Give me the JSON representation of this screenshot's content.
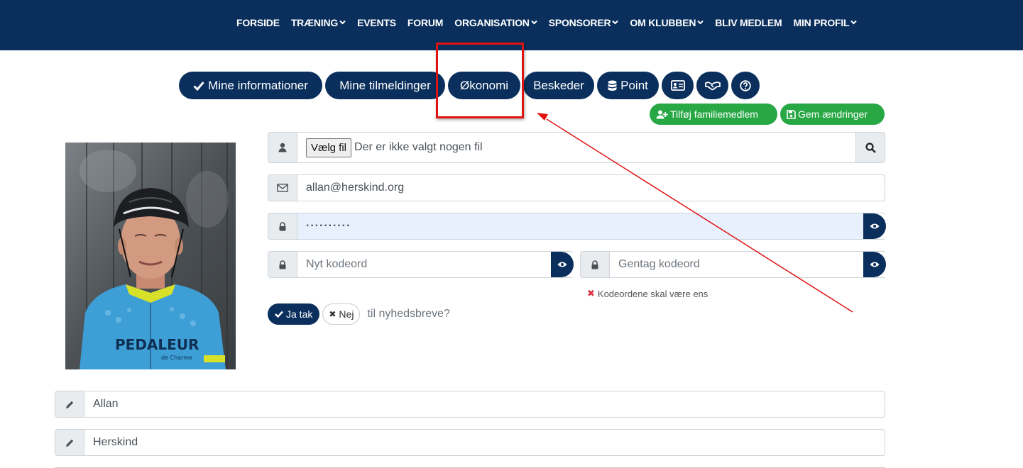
{
  "nav": {
    "items": [
      {
        "label": "FORSIDE",
        "dropdown": false
      },
      {
        "label": "TRÆNING",
        "dropdown": true
      },
      {
        "label": "EVENTS",
        "dropdown": false
      },
      {
        "label": "FORUM",
        "dropdown": false
      },
      {
        "label": "ORGANISATION",
        "dropdown": true
      },
      {
        "label": "SPONSORER",
        "dropdown": true
      },
      {
        "label": "OM KLUBBEN",
        "dropdown": true
      },
      {
        "label": "BLIV MEDLEM",
        "dropdown": false
      },
      {
        "label": "MIN PROFIL",
        "dropdown": true
      }
    ]
  },
  "tabs": {
    "mine_informationer": "Mine informationer",
    "mine_tilmeldinger": "Mine tilmeldinger",
    "okonomi": "Økonomi",
    "beskeder": "Beskeder",
    "point": "Point",
    "icons": [
      "id-card-icon",
      "handshake-icon",
      "question-circle-icon"
    ]
  },
  "actions": {
    "add_family": "Tilføj familiemedlem",
    "save": "Gem ændringer"
  },
  "form": {
    "file_button": "Vælg fil",
    "file_status": "Der er ikke valgt nogen fil",
    "email": "allan@herskind.org",
    "password_masked": "··········",
    "new_password_placeholder": "Nyt kodeord",
    "repeat_password_placeholder": "Gentag kodeord",
    "password_error": "Kodeordene skal være ens",
    "newsletter_yes": "Ja tak",
    "newsletter_no": "Nej",
    "newsletter_question": "til nyhedsbreve?",
    "first_name": "Allan",
    "last_name": "Herskind"
  },
  "photo": {
    "jersey_text": "PEDALEUR",
    "jersey_subtext": "de Charme"
  },
  "colors": {
    "brand_navy": "#0a2f5c",
    "green": "#28a745",
    "annotation_red": "#e01212",
    "error_red": "#dc3545"
  }
}
